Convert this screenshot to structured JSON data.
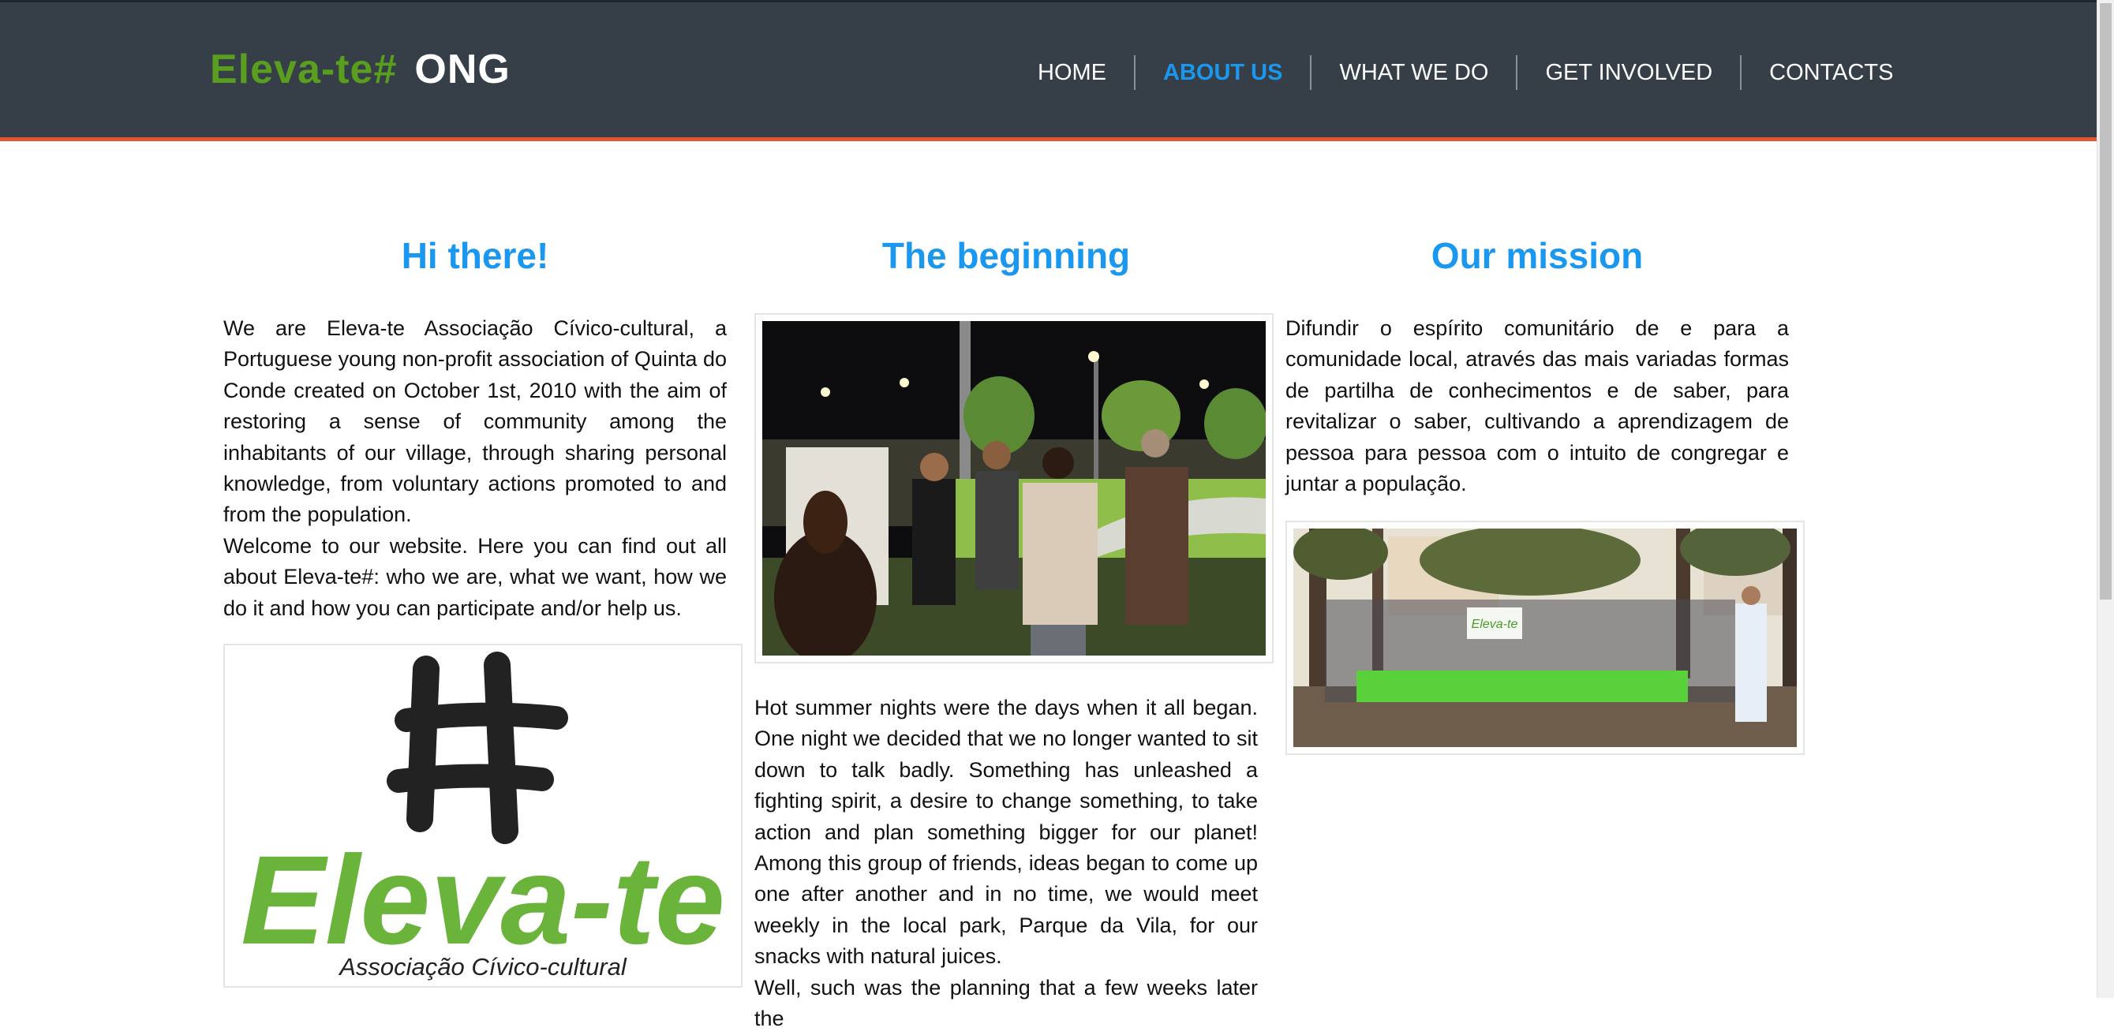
{
  "header": {
    "logo_main": "Eleva-te#",
    "logo_sub": "ONG",
    "nav": [
      {
        "label": "HOME"
      },
      {
        "label": "ABOUT US"
      },
      {
        "label": "WHAT WE DO"
      },
      {
        "label": "GET INVOLVED"
      },
      {
        "label": "CONTACTS"
      }
    ],
    "active_nav": "ABOUT US"
  },
  "columns": {
    "left": {
      "title": "Hi there!",
      "paragraphs": [
        "We are Eleva-te Associação Cívico-cultural, a Portuguese young non-profit association of Quinta do Conde created on October 1st, 2010 with the aim of restoring a sense of community among the inhabitants of our village, through sharing personal knowledge, from voluntary actions promoted to and from the population.",
        "Welcome to our website. Here you can find out all about Eleva-te#: who we are, what we want, how we do it and how you can participate and/or help us."
      ],
      "logo_word": "Eleva-te",
      "logo_tagline": "Associação Cívico-cultural"
    },
    "middle": {
      "title": "The beginning",
      "paragraphs": [
        "Hot summer nights were the days when it all began. One night we decided that we no longer wanted to sit down to talk badly. Something has unleashed a fighting spirit, a desire to change something, to take action and plan something bigger for our planet! Among this group of friends, ideas began to come up one after another and in no time, we would meet weekly in the local park, Parque da Vila, for our snacks with natural juices.",
        "Well, such was the planning that a few weeks later the"
      ]
    },
    "right": {
      "title": "Our mission",
      "paragraphs": [
        "Difundir o espírito comunitário de e para a comunidade local, através das mais variadas formas de partilha de conhecimentos e de saber, para revitalizar o saber, cultivando a aprendizagem de pessoa para pessoa com o intuito de congregar e juntar a população."
      ],
      "banner_text": "Eleva-te"
    }
  },
  "colors": {
    "header_bg": "#363f47",
    "accent_line": "#e2562f",
    "title_blue": "#1a97ef",
    "logo_green": "#5a9e1f"
  }
}
